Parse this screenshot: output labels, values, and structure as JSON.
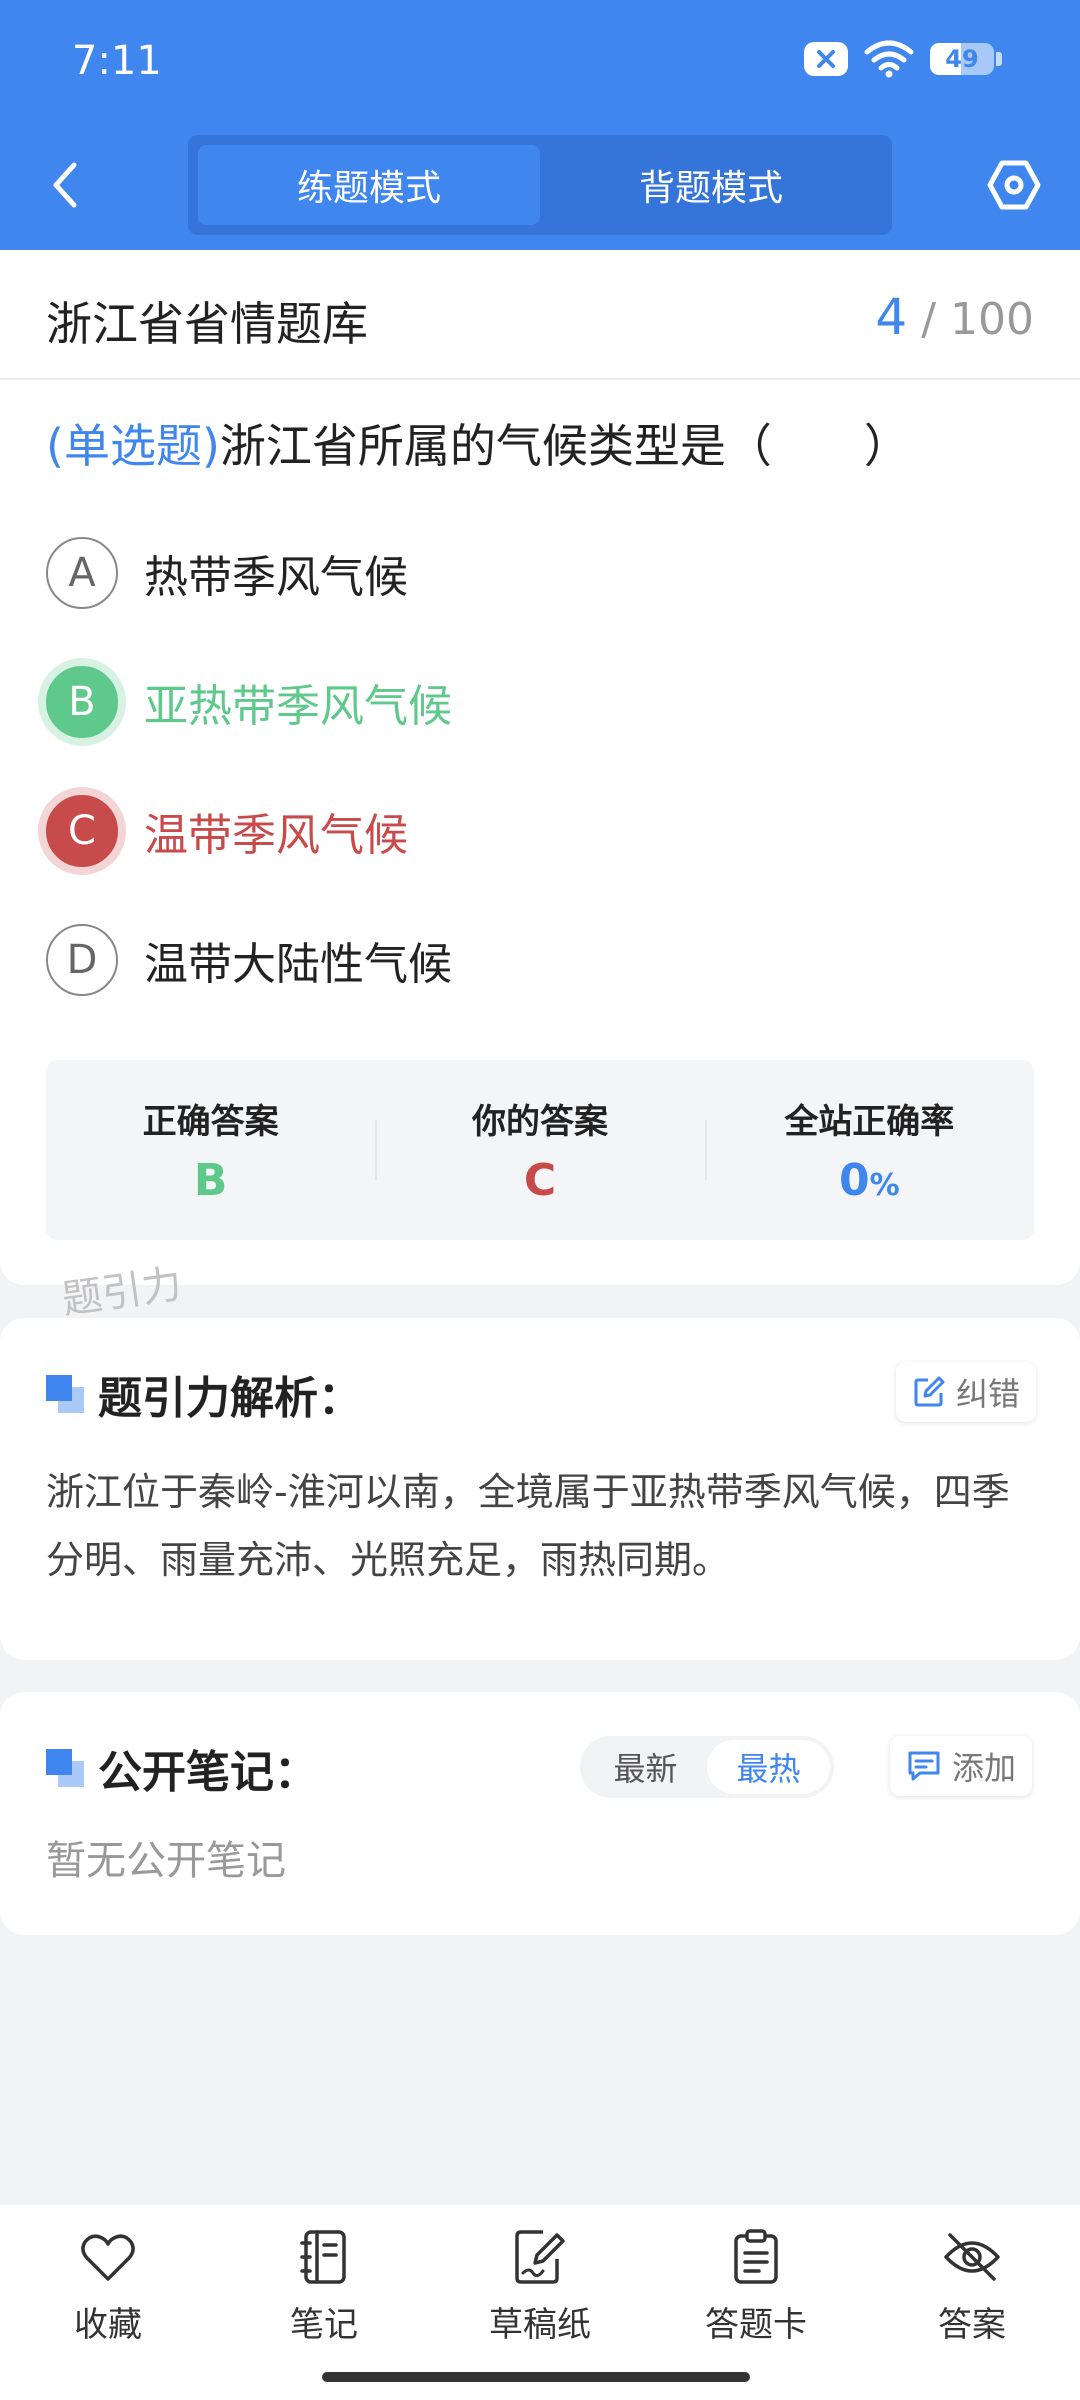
{
  "status_bar": {
    "time": "7:11",
    "battery_level": "49",
    "battery_fraction": 0.49
  },
  "header": {
    "tabs": [
      {
        "label": "练题模式",
        "active": true
      },
      {
        "label": "背题模式",
        "active": false
      }
    ],
    "accent_color": "#3f86ee"
  },
  "question": {
    "bank_title": "浙江省省情题库",
    "current": "4",
    "total": "100",
    "progress_sep": "/",
    "type_label": "(单选题)",
    "text": "浙江省所属的气候类型是（　　）",
    "options": [
      {
        "letter": "A",
        "text": "热带季风气候",
        "state": "normal"
      },
      {
        "letter": "B",
        "text": "亚热带季风气候",
        "state": "correct"
      },
      {
        "letter": "C",
        "text": "温带季风气候",
        "state": "wrong"
      },
      {
        "letter": "D",
        "text": "温带大陆性气候",
        "state": "normal"
      }
    ]
  },
  "result": {
    "correct_label": "正确答案",
    "correct_value": "B",
    "yours_label": "你的答案",
    "yours_value": "C",
    "rate_label": "全站正确率",
    "rate_value": "0",
    "rate_unit": "%"
  },
  "watermark": "题引力",
  "analysis": {
    "title": "题引力解析：",
    "report_label": "纠错",
    "text": "浙江位于秦岭-淮河以南，全境属于亚热带季风气候，四季分明、雨量充沛、光照充足，雨热同期。"
  },
  "notes": {
    "title": "公开笔记：",
    "sort_options": [
      "最新",
      "最热"
    ],
    "add_label": "添加",
    "empty_text": "暂无公开笔记"
  },
  "bottom_nav": [
    {
      "label": "收藏",
      "icon": "heart-icon"
    },
    {
      "label": "笔记",
      "icon": "notebook-icon"
    },
    {
      "label": "草稿纸",
      "icon": "draft-icon"
    },
    {
      "label": "答题卡",
      "icon": "clipboard-icon"
    },
    {
      "label": "答案",
      "icon": "eye-off-icon"
    }
  ],
  "colors": {
    "correct": "#5fc88b",
    "wrong": "#c84b4b",
    "accent": "#3f86ee"
  }
}
